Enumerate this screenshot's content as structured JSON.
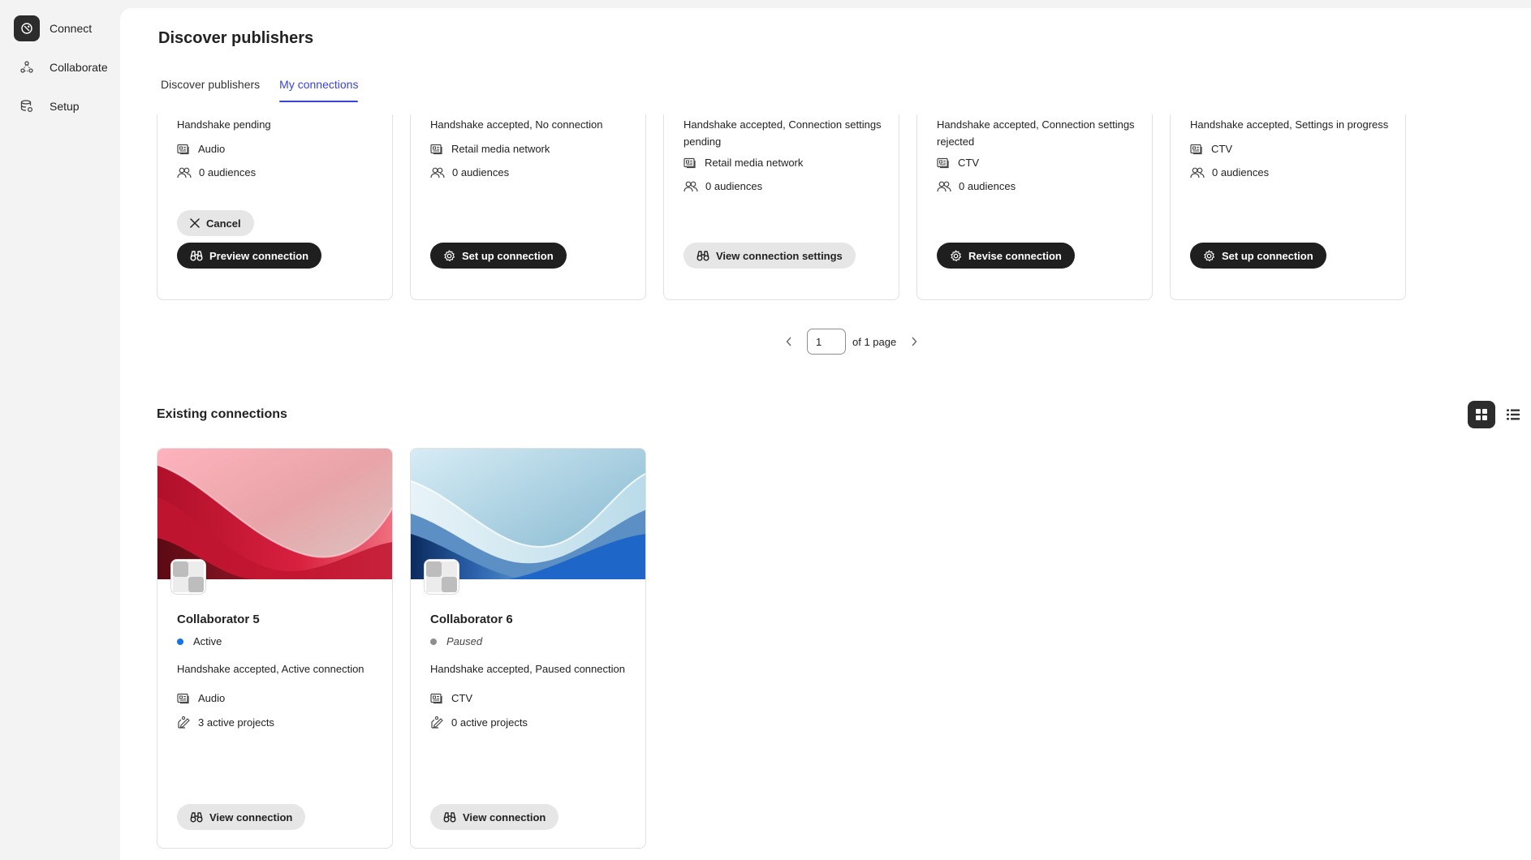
{
  "sidebar": {
    "items": [
      {
        "label": "Connect",
        "icon": "connect-icon",
        "active": true
      },
      {
        "label": "Collaborate",
        "icon": "collaborate-icon",
        "active": false
      },
      {
        "label": "Setup",
        "icon": "setup-icon",
        "active": false
      }
    ]
  },
  "page": {
    "title": "Discover publishers"
  },
  "tabs": [
    {
      "label": "Discover publishers",
      "selected": false
    },
    {
      "label": "My connections",
      "selected": true
    }
  ],
  "top_cards": [
    {
      "status": "Handshake pending",
      "type": "Audio",
      "audiences": "0 audiences",
      "secondary_button": "Cancel",
      "button": "Preview connection",
      "button_style": "dark",
      "button_icon": "binoculars-icon"
    },
    {
      "status": "Handshake accepted, No connection",
      "type": "Retail media network",
      "audiences": "0 audiences",
      "button": "Set up connection",
      "button_style": "dark",
      "button_icon": "gear-icon"
    },
    {
      "status": "Handshake accepted, Connection settings pending",
      "type": "Retail media network",
      "audiences": "0 audiences",
      "button": "View connection settings",
      "button_style": "light",
      "button_icon": "binoculars-icon"
    },
    {
      "status": "Handshake accepted, Connection settings rejected",
      "type": "CTV",
      "audiences": "0 audiences",
      "button": "Revise connection",
      "button_style": "dark",
      "button_icon": "gear-icon"
    },
    {
      "status": "Handshake accepted, Settings in progress",
      "type": "CTV",
      "audiences": "0 audiences",
      "button": "Set up connection",
      "button_style": "dark",
      "button_icon": "gear-icon"
    }
  ],
  "pagination": {
    "current": "1",
    "label": "of 1 page"
  },
  "existing": {
    "title": "Existing connections",
    "cards": [
      {
        "name": "Collaborator 5",
        "status": "Active",
        "status_color": "#1473e6",
        "handshake": "Handshake accepted, Active connection",
        "type": "Audio",
        "projects": "3 active projects",
        "button": "View connection"
      },
      {
        "name": "Collaborator 6",
        "status": "Paused",
        "status_color": "#8e8e8e",
        "handshake": "Handshake accepted, Paused connection",
        "type": "CTV",
        "projects": "0 active projects",
        "button": "View connection"
      }
    ]
  },
  "colors": {
    "accent": "#3a43d9",
    "dark_button": "#1f1f1f",
    "light_button": "#e6e6e6"
  }
}
